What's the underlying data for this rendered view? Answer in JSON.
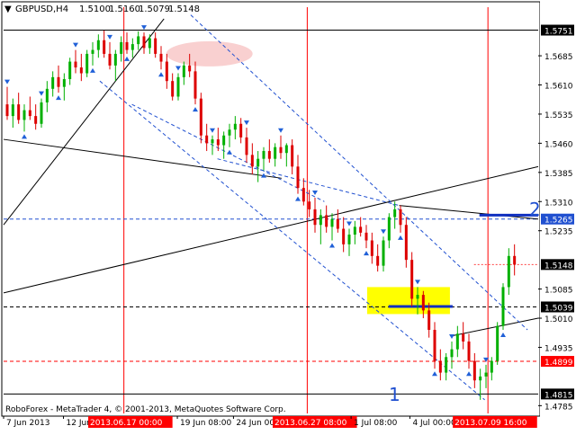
{
  "header": {
    "symbol_label": "GBPUSD,H4",
    "open": "1.5100",
    "high": "1.5160",
    "low": "1.5079",
    "close": "1.5148"
  },
  "footer_copyright": "RoboForex - MetaTrader 4, © 2001-2013, MetaQuotes Software Corp.",
  "wave_labels": {
    "one": "1",
    "two": "2"
  },
  "colors": {
    "bull": "#00b000",
    "bear": "#dd0000",
    "grid": "#000000",
    "marker_blue": "#2060d8",
    "level_red": "#ff0000",
    "price_box": "#ffffff",
    "highlight_yellow": "#ffff00",
    "highlight_pink": "#f8c8c8"
  },
  "chart_data": {
    "type": "candlestick",
    "title": "GBPUSD,H4",
    "y_tick_labels": [
      "1.5751",
      "1.5685",
      "1.5610",
      "1.5535",
      "1.5460",
      "1.5385",
      "1.5310",
      "1.5265",
      "1.5235",
      "1.5148",
      "1.5085",
      "1.5039",
      "1.5010",
      "1.4935",
      "1.4899",
      "1.4815",
      "1.4785"
    ],
    "highlighted_levels": [
      {
        "value": 1.5751,
        "label": "1.5751",
        "style": "black"
      },
      {
        "value": 1.5265,
        "label": "1.5265",
        "style": "blue-dashed"
      },
      {
        "value": 1.5148,
        "label": "1.5148",
        "style": "current"
      },
      {
        "value": 1.5039,
        "label": "1.5039",
        "style": "black-dashed"
      },
      {
        "value": 1.4899,
        "label": "1.4899",
        "style": "red-dashed"
      },
      {
        "value": 1.4815,
        "label": "1.4815",
        "style": "black"
      }
    ],
    "y_range": [
      1.4765,
      1.581
    ],
    "x_tick_labels": [
      "7 Jun 2013",
      "12 Jun 08:00",
      "2013.06.17 00:00",
      "19 Jun 08:00",
      "24 Jun 00:00",
      "2013.06.27 08:00",
      "1 Jul 08:00",
      "4 Jul 00:00",
      "2013.07.09 16:00"
    ],
    "vertical_markers": [
      "2013.06.17 00:00",
      "2013.06.27 08:00",
      "2013.07.09 16:00"
    ],
    "candles": [
      [
        1.556,
        1.5605,
        1.552,
        1.553
      ],
      [
        1.553,
        1.5575,
        1.55,
        1.556
      ],
      [
        1.556,
        1.559,
        1.551,
        1.552
      ],
      [
        1.552,
        1.556,
        1.549,
        1.5545
      ],
      [
        1.5545,
        1.558,
        1.552,
        1.553
      ],
      [
        1.553,
        1.556,
        1.5495,
        1.551
      ],
      [
        1.551,
        1.5575,
        1.55,
        1.5565
      ],
      [
        1.5565,
        1.562,
        1.554,
        1.56
      ],
      [
        1.56,
        1.5645,
        1.558,
        1.563
      ],
      [
        1.563,
        1.566,
        1.559,
        1.5605
      ],
      [
        1.5605,
        1.564,
        1.557,
        1.5625
      ],
      [
        1.5625,
        1.568,
        1.561,
        1.567
      ],
      [
        1.567,
        1.57,
        1.564,
        1.5655
      ],
      [
        1.5655,
        1.569,
        1.562,
        1.564
      ],
      [
        1.564,
        1.57,
        1.563,
        1.569
      ],
      [
        1.569,
        1.572,
        1.566,
        1.57
      ],
      [
        1.57,
        1.574,
        1.568,
        1.5725
      ],
      [
        1.5725,
        1.575,
        1.568,
        1.569
      ],
      [
        1.569,
        1.572,
        1.565,
        1.566
      ],
      [
        1.566,
        1.57,
        1.562,
        1.569
      ],
      [
        1.569,
        1.5735,
        1.567,
        1.572
      ],
      [
        1.572,
        1.5745,
        1.569,
        1.57
      ],
      [
        1.57,
        1.573,
        1.568,
        1.5715
      ],
      [
        1.5715,
        1.5748,
        1.57,
        1.5735
      ],
      [
        1.5735,
        1.5745,
        1.569,
        1.5705
      ],
      [
        1.5705,
        1.574,
        1.569,
        1.573
      ],
      [
        1.573,
        1.5745,
        1.568,
        1.569
      ],
      [
        1.569,
        1.571,
        1.565,
        1.567
      ],
      [
        1.567,
        1.569,
        1.56,
        1.562
      ],
      [
        1.562,
        1.564,
        1.557,
        1.558
      ],
      [
        1.558,
        1.564,
        1.557,
        1.563
      ],
      [
        1.563,
        1.567,
        1.561,
        1.566
      ],
      [
        1.566,
        1.569,
        1.563,
        1.5645
      ],
      [
        1.5645,
        1.567,
        1.556,
        1.5575
      ],
      [
        1.5575,
        1.559,
        1.546,
        1.548
      ],
      [
        1.548,
        1.551,
        1.544,
        1.546
      ],
      [
        1.546,
        1.548,
        1.543,
        1.547
      ],
      [
        1.547,
        1.55,
        1.544,
        1.5455
      ],
      [
        1.5455,
        1.549,
        1.542,
        1.548
      ],
      [
        1.548,
        1.551,
        1.545,
        1.5495
      ],
      [
        1.5495,
        1.553,
        1.547,
        1.551
      ],
      [
        1.551,
        1.5525,
        1.546,
        1.5475
      ],
      [
        1.5475,
        1.55,
        1.541,
        1.543
      ],
      [
        1.543,
        1.546,
        1.538,
        1.54
      ],
      [
        1.54,
        1.544,
        1.536,
        1.542
      ],
      [
        1.542,
        1.545,
        1.539,
        1.544
      ],
      [
        1.544,
        1.547,
        1.541,
        1.542
      ],
      [
        1.542,
        1.546,
        1.54,
        1.545
      ],
      [
        1.545,
        1.548,
        1.542,
        1.5435
      ],
      [
        1.5435,
        1.546,
        1.54,
        1.5455
      ],
      [
        1.5455,
        1.547,
        1.538,
        1.54
      ],
      [
        1.54,
        1.543,
        1.533,
        1.5345
      ],
      [
        1.5345,
        1.537,
        1.53,
        1.531
      ],
      [
        1.531,
        1.534,
        1.527,
        1.529
      ],
      [
        1.529,
        1.532,
        1.523,
        1.525
      ],
      [
        1.525,
        1.529,
        1.52,
        1.5275
      ],
      [
        1.5275,
        1.53,
        1.523,
        1.5245
      ],
      [
        1.5245,
        1.528,
        1.521,
        1.5265
      ],
      [
        1.5265,
        1.529,
        1.523,
        1.524
      ],
      [
        1.524,
        1.527,
        1.518,
        1.52
      ],
      [
        1.52,
        1.524,
        1.517,
        1.5225
      ],
      [
        1.5225,
        1.526,
        1.52,
        1.5245
      ],
      [
        1.5245,
        1.527,
        1.522,
        1.523
      ],
      [
        1.523,
        1.525,
        1.519,
        1.521
      ],
      [
        1.521,
        1.523,
        1.515,
        1.517
      ],
      [
        1.517,
        1.52,
        1.513,
        1.5145
      ],
      [
        1.5145,
        1.522,
        1.513,
        1.521
      ],
      [
        1.521,
        1.528,
        1.519,
        1.527
      ],
      [
        1.527,
        1.531,
        1.524,
        1.529
      ],
      [
        1.529,
        1.53,
        1.523,
        1.525
      ],
      [
        1.525,
        1.527,
        1.514,
        1.516
      ],
      [
        1.516,
        1.518,
        1.504,
        1.506
      ],
      [
        1.506,
        1.509,
        1.502,
        1.507
      ],
      [
        1.507,
        1.508,
        1.501,
        1.503
      ],
      [
        1.503,
        1.505,
        1.496,
        1.498
      ],
      [
        1.498,
        1.5,
        1.488,
        1.49
      ],
      [
        1.49,
        1.493,
        1.485,
        1.487
      ],
      [
        1.487,
        1.492,
        1.485,
        1.491
      ],
      [
        1.491,
        1.495,
        1.488,
        1.493
      ],
      [
        1.493,
        1.499,
        1.491,
        1.497
      ],
      [
        1.497,
        1.5,
        1.493,
        1.495
      ],
      [
        1.495,
        1.497,
        1.488,
        1.49
      ],
      [
        1.49,
        1.492,
        1.483,
        1.485
      ],
      [
        1.485,
        1.488,
        1.48,
        1.486
      ],
      [
        1.486,
        1.489,
        1.483,
        1.487
      ],
      [
        1.487,
        1.491,
        1.485,
        1.49
      ],
      [
        1.49,
        1.5,
        1.489,
        1.499
      ],
      [
        1.499,
        1.51,
        1.498,
        1.509
      ],
      [
        1.509,
        1.519,
        1.507,
        1.517
      ],
      [
        1.517,
        1.52,
        1.512,
        1.5148
      ]
    ]
  }
}
